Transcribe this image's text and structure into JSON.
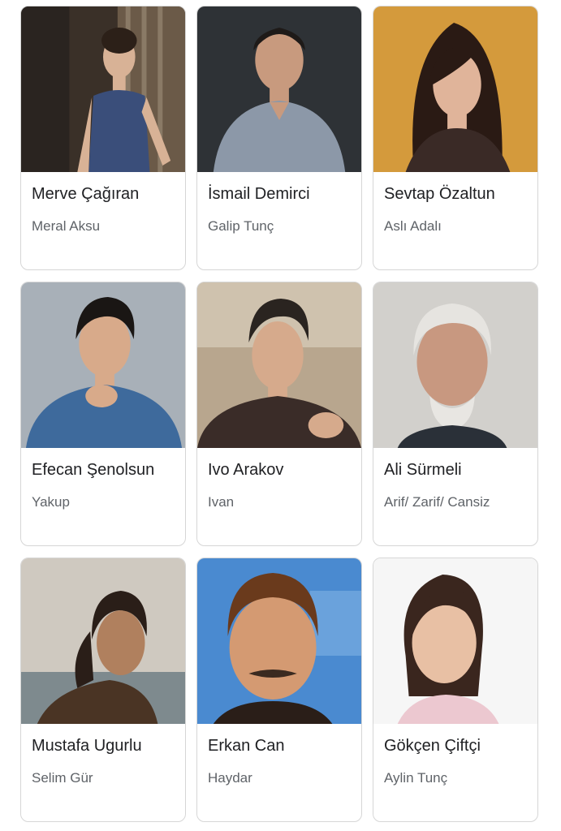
{
  "cast": [
    {
      "actor": "Merve Çağıran",
      "role": "Meral Aksu"
    },
    {
      "actor": "İsmail Demirci",
      "role": "Galip Tunç"
    },
    {
      "actor": "Sevtap Özaltun",
      "role": "Aslı Adalı"
    },
    {
      "actor": "Efecan Şenolsun",
      "role": "Yakup"
    },
    {
      "actor": "Ivo Arakov",
      "role": "Ivan"
    },
    {
      "actor": "Ali Sürmeli",
      "role": "Arif/ Zarif/ Cansiz"
    },
    {
      "actor": "Mustafa Ugurlu",
      "role": "Selim Gür"
    },
    {
      "actor": "Erkan Can",
      "role": "Haydar"
    },
    {
      "actor": "Gökçen Çiftçi",
      "role": "Aylin Tunç"
    }
  ]
}
